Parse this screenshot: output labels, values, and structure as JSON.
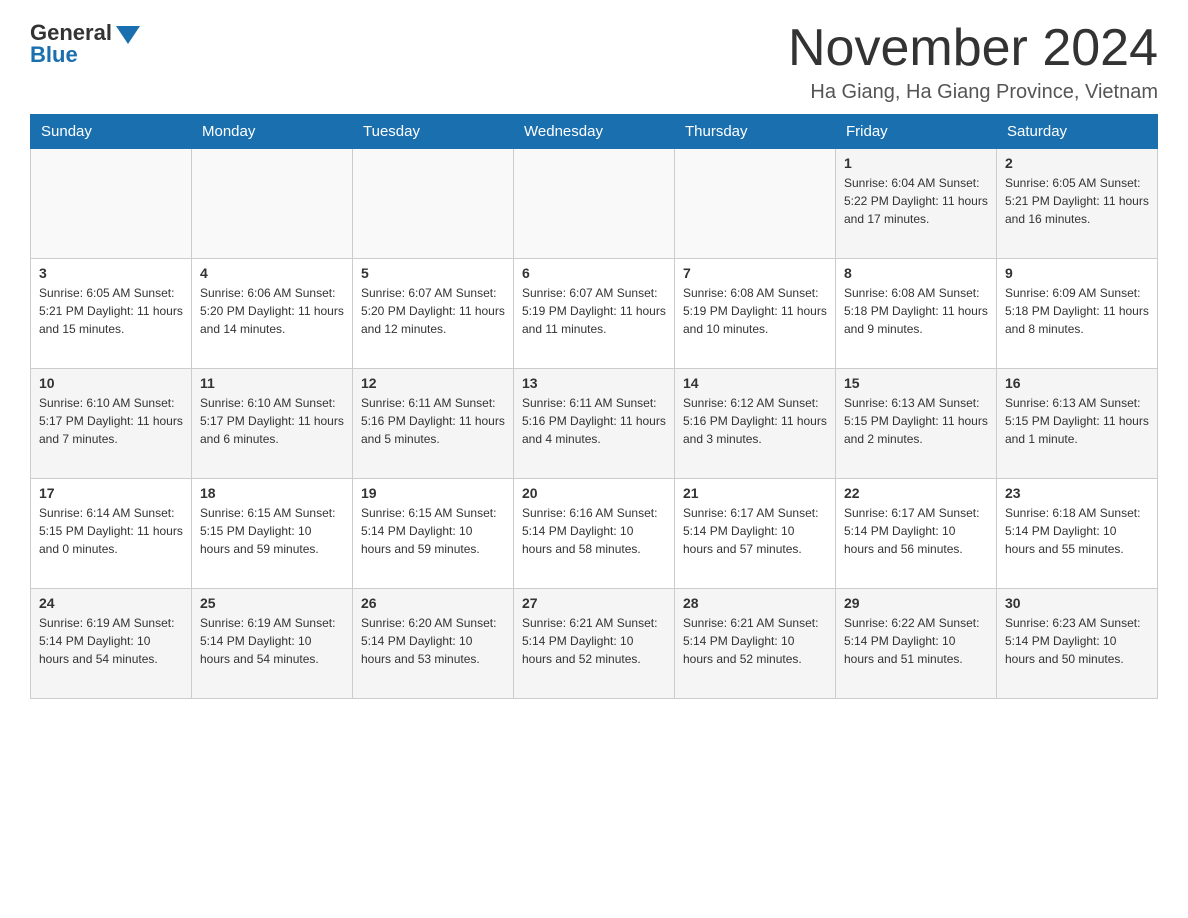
{
  "header": {
    "logo_general": "General",
    "logo_blue": "Blue",
    "title": "November 2024",
    "location": "Ha Giang, Ha Giang Province, Vietnam"
  },
  "calendar": {
    "days_of_week": [
      "Sunday",
      "Monday",
      "Tuesday",
      "Wednesday",
      "Thursday",
      "Friday",
      "Saturday"
    ],
    "weeks": [
      [
        {
          "day": "",
          "info": ""
        },
        {
          "day": "",
          "info": ""
        },
        {
          "day": "",
          "info": ""
        },
        {
          "day": "",
          "info": ""
        },
        {
          "day": "",
          "info": ""
        },
        {
          "day": "1",
          "info": "Sunrise: 6:04 AM\nSunset: 5:22 PM\nDaylight: 11 hours and 17 minutes."
        },
        {
          "day": "2",
          "info": "Sunrise: 6:05 AM\nSunset: 5:21 PM\nDaylight: 11 hours and 16 minutes."
        }
      ],
      [
        {
          "day": "3",
          "info": "Sunrise: 6:05 AM\nSunset: 5:21 PM\nDaylight: 11 hours and 15 minutes."
        },
        {
          "day": "4",
          "info": "Sunrise: 6:06 AM\nSunset: 5:20 PM\nDaylight: 11 hours and 14 minutes."
        },
        {
          "day": "5",
          "info": "Sunrise: 6:07 AM\nSunset: 5:20 PM\nDaylight: 11 hours and 12 minutes."
        },
        {
          "day": "6",
          "info": "Sunrise: 6:07 AM\nSunset: 5:19 PM\nDaylight: 11 hours and 11 minutes."
        },
        {
          "day": "7",
          "info": "Sunrise: 6:08 AM\nSunset: 5:19 PM\nDaylight: 11 hours and 10 minutes."
        },
        {
          "day": "8",
          "info": "Sunrise: 6:08 AM\nSunset: 5:18 PM\nDaylight: 11 hours and 9 minutes."
        },
        {
          "day": "9",
          "info": "Sunrise: 6:09 AM\nSunset: 5:18 PM\nDaylight: 11 hours and 8 minutes."
        }
      ],
      [
        {
          "day": "10",
          "info": "Sunrise: 6:10 AM\nSunset: 5:17 PM\nDaylight: 11 hours and 7 minutes."
        },
        {
          "day": "11",
          "info": "Sunrise: 6:10 AM\nSunset: 5:17 PM\nDaylight: 11 hours and 6 minutes."
        },
        {
          "day": "12",
          "info": "Sunrise: 6:11 AM\nSunset: 5:16 PM\nDaylight: 11 hours and 5 minutes."
        },
        {
          "day": "13",
          "info": "Sunrise: 6:11 AM\nSunset: 5:16 PM\nDaylight: 11 hours and 4 minutes."
        },
        {
          "day": "14",
          "info": "Sunrise: 6:12 AM\nSunset: 5:16 PM\nDaylight: 11 hours and 3 minutes."
        },
        {
          "day": "15",
          "info": "Sunrise: 6:13 AM\nSunset: 5:15 PM\nDaylight: 11 hours and 2 minutes."
        },
        {
          "day": "16",
          "info": "Sunrise: 6:13 AM\nSunset: 5:15 PM\nDaylight: 11 hours and 1 minute."
        }
      ],
      [
        {
          "day": "17",
          "info": "Sunrise: 6:14 AM\nSunset: 5:15 PM\nDaylight: 11 hours and 0 minutes."
        },
        {
          "day": "18",
          "info": "Sunrise: 6:15 AM\nSunset: 5:15 PM\nDaylight: 10 hours and 59 minutes."
        },
        {
          "day": "19",
          "info": "Sunrise: 6:15 AM\nSunset: 5:14 PM\nDaylight: 10 hours and 59 minutes."
        },
        {
          "day": "20",
          "info": "Sunrise: 6:16 AM\nSunset: 5:14 PM\nDaylight: 10 hours and 58 minutes."
        },
        {
          "day": "21",
          "info": "Sunrise: 6:17 AM\nSunset: 5:14 PM\nDaylight: 10 hours and 57 minutes."
        },
        {
          "day": "22",
          "info": "Sunrise: 6:17 AM\nSunset: 5:14 PM\nDaylight: 10 hours and 56 minutes."
        },
        {
          "day": "23",
          "info": "Sunrise: 6:18 AM\nSunset: 5:14 PM\nDaylight: 10 hours and 55 minutes."
        }
      ],
      [
        {
          "day": "24",
          "info": "Sunrise: 6:19 AM\nSunset: 5:14 PM\nDaylight: 10 hours and 54 minutes."
        },
        {
          "day": "25",
          "info": "Sunrise: 6:19 AM\nSunset: 5:14 PM\nDaylight: 10 hours and 54 minutes."
        },
        {
          "day": "26",
          "info": "Sunrise: 6:20 AM\nSunset: 5:14 PM\nDaylight: 10 hours and 53 minutes."
        },
        {
          "day": "27",
          "info": "Sunrise: 6:21 AM\nSunset: 5:14 PM\nDaylight: 10 hours and 52 minutes."
        },
        {
          "day": "28",
          "info": "Sunrise: 6:21 AM\nSunset: 5:14 PM\nDaylight: 10 hours and 52 minutes."
        },
        {
          "day": "29",
          "info": "Sunrise: 6:22 AM\nSunset: 5:14 PM\nDaylight: 10 hours and 51 minutes."
        },
        {
          "day": "30",
          "info": "Sunrise: 6:23 AM\nSunset: 5:14 PM\nDaylight: 10 hours and 50 minutes."
        }
      ]
    ]
  }
}
